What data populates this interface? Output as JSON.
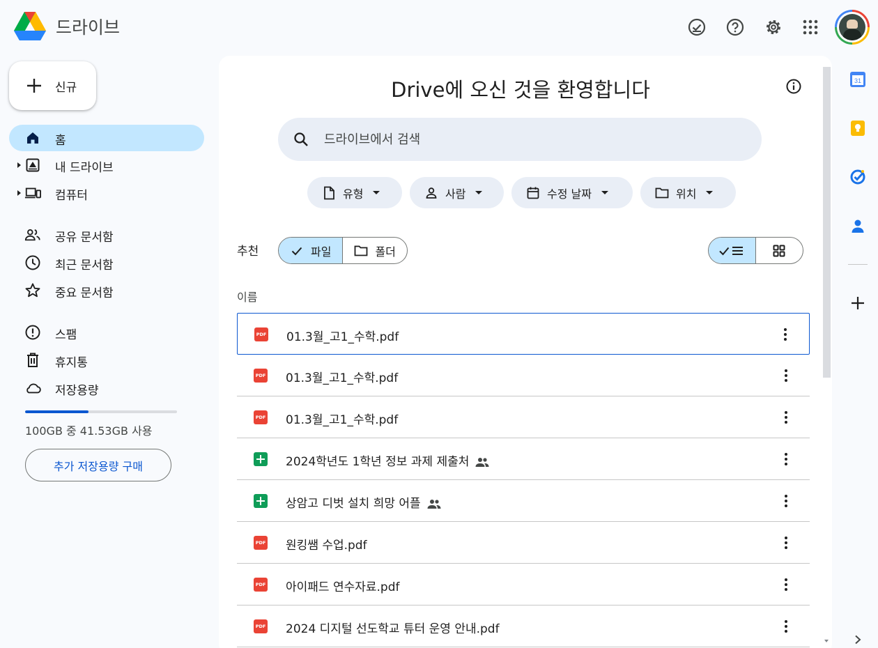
{
  "app": {
    "title": "드라이브"
  },
  "header_icons": [
    "ready-for-offline-icon",
    "help-icon",
    "settings-icon",
    "apps-grid-icon",
    "account-avatar"
  ],
  "sidebar": {
    "new_label": "신규",
    "items": [
      {
        "label": "홈",
        "icon": "home-icon",
        "active": true
      },
      {
        "label": "내 드라이브",
        "icon": "my-drive-icon"
      },
      {
        "label": "컴퓨터",
        "icon": "computers-icon"
      },
      {
        "label": "공유 문서함",
        "icon": "shared-icon"
      },
      {
        "label": "최근 문서함",
        "icon": "recent-icon"
      },
      {
        "label": "중요 문서함",
        "icon": "starred-icon"
      },
      {
        "label": "스팸",
        "icon": "spam-icon"
      },
      {
        "label": "휴지통",
        "icon": "trash-icon"
      },
      {
        "label": "저장용량",
        "icon": "cloud-icon"
      }
    ],
    "storage": {
      "text": "100GB 중 41.53GB 사용",
      "used_fraction": 0.4153
    },
    "buy_storage_label": "추가 저장용량 구매"
  },
  "main": {
    "welcome": "Drive에 오신 것을 환영합니다",
    "search_placeholder": "드라이브에서 검색",
    "filters": [
      {
        "label": "유형",
        "icon": "file-type-icon"
      },
      {
        "label": "사람",
        "icon": "person-icon"
      },
      {
        "label": "수정 날짜",
        "icon": "calendar-icon"
      },
      {
        "label": "위치",
        "icon": "folder-icon"
      }
    ],
    "suggested_label": "추천",
    "toggle": {
      "files": "파일",
      "folders": "폴더"
    },
    "column_name": "이름",
    "files": [
      {
        "name": "01.3월_고1_수학.pdf",
        "type": "pdf",
        "shared": false
      },
      {
        "name": "01.3월_고1_수학.pdf",
        "type": "pdf",
        "shared": false
      },
      {
        "name": "01.3월_고1_수학.pdf",
        "type": "pdf",
        "shared": false
      },
      {
        "name": "2024학년도 1학년 정보 과제 제출처",
        "type": "sheet",
        "shared": true
      },
      {
        "name": "상암고 디벗 설치 희망 어플",
        "type": "sheet",
        "shared": true
      },
      {
        "name": "원킹쌤 수업.pdf",
        "type": "pdf",
        "shared": false
      },
      {
        "name": "아이패드 연수자료.pdf",
        "type": "pdf",
        "shared": false
      },
      {
        "name": "2024 디지털 선도학교 튜터 운영 안내.pdf",
        "type": "pdf",
        "shared": false
      }
    ],
    "pdf_badge": "PDF"
  },
  "right_rail": [
    "calendar-icon",
    "keep-icon",
    "tasks-icon",
    "contacts-icon",
    "add-addon-icon",
    "expand-panel-icon"
  ],
  "colors": {
    "accent": "#0b57d0",
    "active_bg": "#c2e7ff",
    "search_bg": "#e9eef6",
    "pdf": "#ea4335",
    "sheets": "#0f9d58"
  }
}
